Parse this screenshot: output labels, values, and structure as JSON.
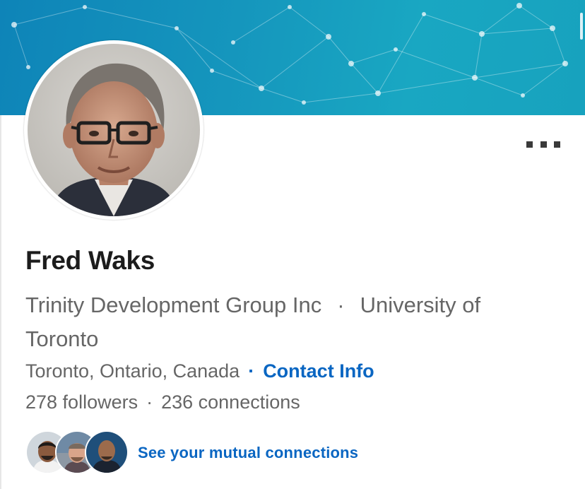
{
  "profile": {
    "name": "Fred Waks",
    "headline_company": "Trinity Development Group Inc",
    "headline_separator": "·",
    "headline_school": "University of Toronto",
    "location": "Toronto, Ontario, Canada",
    "location_separator": "·",
    "contact_label": "Contact Info",
    "followers": "278 followers",
    "counts_separator": "·",
    "connections": "236 connections",
    "mutual_label": "See your mutual connections"
  },
  "icons": {
    "more": "more-horizontal-icon",
    "avatar": "profile-photo",
    "mutual": [
      "mutual-avatar-1",
      "mutual-avatar-2",
      "mutual-avatar-3"
    ]
  },
  "colors": {
    "link": "#0a66c2",
    "banner": "#1596bd",
    "name": "#1c1c1c",
    "secondary_text": "#666666"
  }
}
